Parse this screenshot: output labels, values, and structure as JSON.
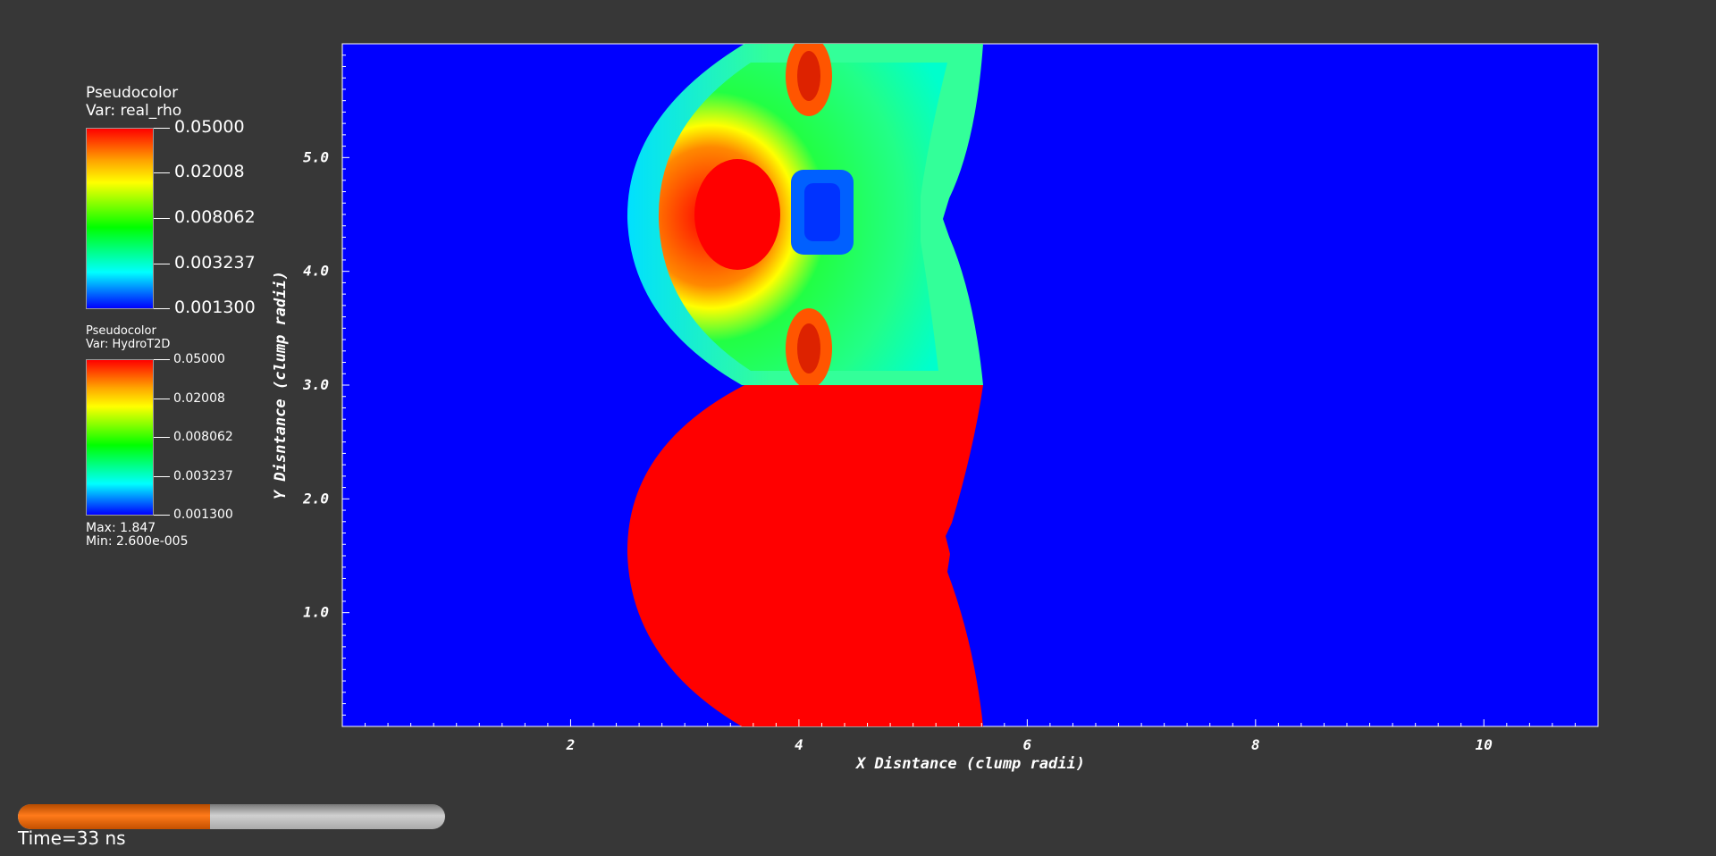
{
  "legend_rho": {
    "title": "Pseudocolor",
    "var": "Var: real_rho",
    "labels": [
      "0.05000",
      "0.02008",
      "0.008062",
      "0.003237",
      "0.001300"
    ]
  },
  "legend_t2d": {
    "title": "Pseudocolor",
    "var": "Var: HydroT2D",
    "labels": [
      "0.05000",
      "0.02008",
      "0.008062",
      "0.003237",
      "0.001300"
    ],
    "max": "Max:  1.847",
    "min": "Min:  2.600e-005"
  },
  "axes": {
    "xlabel": "X Disntance (clump radii)",
    "ylabel": "Y Disntance (clump radii)",
    "xticks": [
      "2",
      "4",
      "6",
      "8",
      "10"
    ],
    "yticks": [
      "1.0",
      "2.0",
      "3.0",
      "4.0",
      "5.0"
    ]
  },
  "time": {
    "label": "Time=33 ns",
    "progress_fraction": 0.45
  },
  "colors": {
    "background": "#373737",
    "field_blue": "#0000ff",
    "field_red": "#ff0000",
    "progress_orange": "#ff7a1a"
  }
}
